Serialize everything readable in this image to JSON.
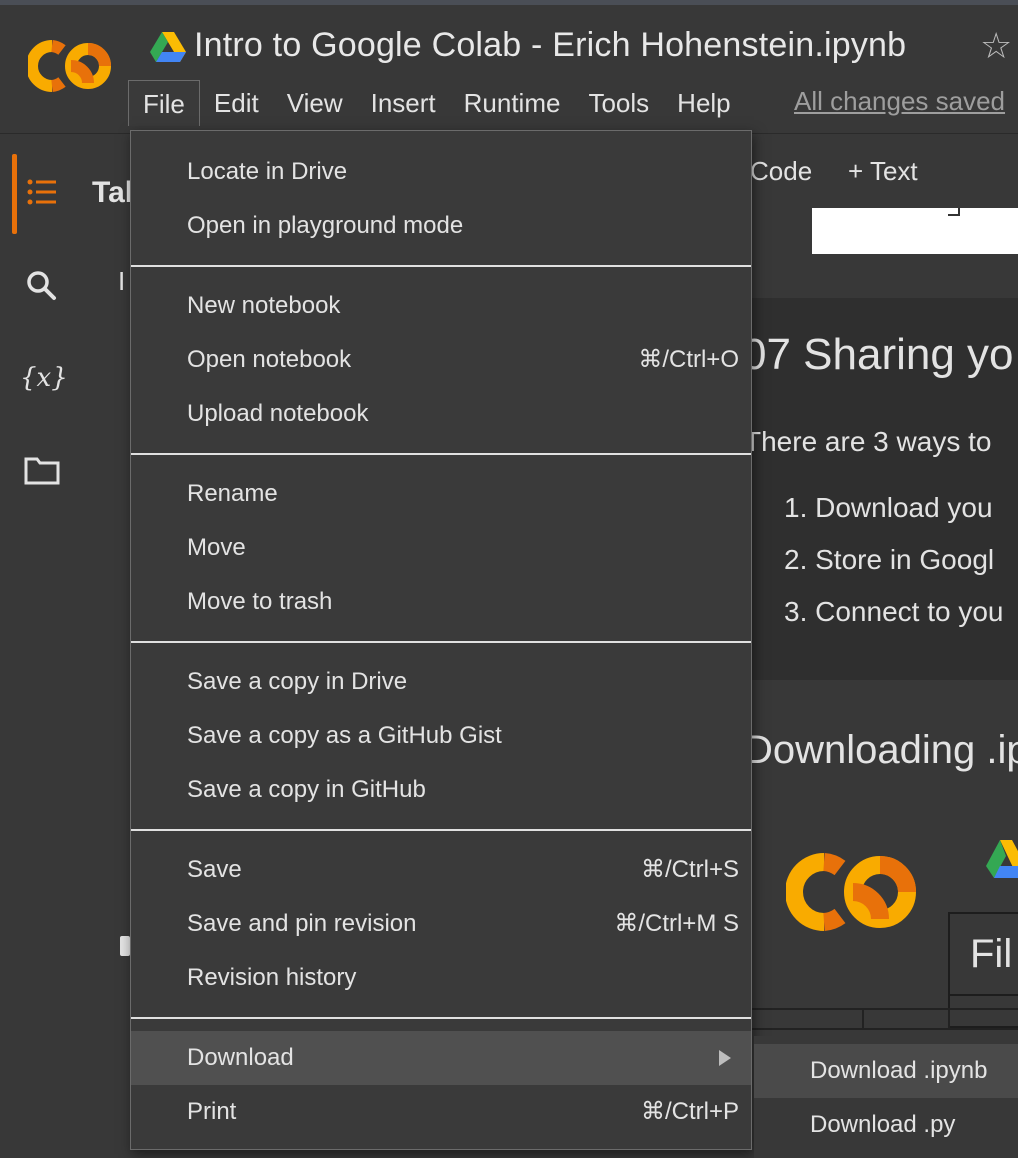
{
  "notebook": {
    "title": "Intro to Google Colab - Erich Hohenstein.ipynb",
    "saved_status": "All changes saved"
  },
  "menubar": [
    "File",
    "Edit",
    "View",
    "Insert",
    "Runtime",
    "Tools",
    "Help"
  ],
  "sidebar": {
    "icons": [
      "toc-icon",
      "search-icon",
      "variables-icon",
      "folder-icon"
    ],
    "variables_glyph": "{x}",
    "accent_color": "#e8710a"
  },
  "toc": {
    "title": "Tal",
    "entry": "I"
  },
  "toolbar": {
    "code": "Code",
    "text": "+ Text"
  },
  "notebook_content": {
    "heading": "07 Sharing yo",
    "paragraph": "There are 3 ways to",
    "list": [
      "1. Download you",
      "2. Store in Googl",
      "3. Connect to you"
    ],
    "heading2": "Downloading .ip",
    "mini_menu": "Fil"
  },
  "file_menu": {
    "groups": [
      [
        {
          "label": "Locate in Drive",
          "shortcut": ""
        },
        {
          "label": "Open in playground mode",
          "shortcut": ""
        }
      ],
      [
        {
          "label": "New notebook",
          "shortcut": ""
        },
        {
          "label": "Open notebook",
          "shortcut": "⌘/Ctrl+O"
        },
        {
          "label": "Upload notebook",
          "shortcut": ""
        }
      ],
      [
        {
          "label": "Rename",
          "shortcut": ""
        },
        {
          "label": "Move",
          "shortcut": ""
        },
        {
          "label": "Move to trash",
          "shortcut": ""
        }
      ],
      [
        {
          "label": "Save a copy in Drive",
          "shortcut": ""
        },
        {
          "label": "Save a copy as a GitHub Gist",
          "shortcut": ""
        },
        {
          "label": "Save a copy in GitHub",
          "shortcut": ""
        }
      ],
      [
        {
          "label": "Save",
          "shortcut": "⌘/Ctrl+S"
        },
        {
          "label": "Save and pin revision",
          "shortcut": "⌘/Ctrl+M S"
        },
        {
          "label": "Revision history",
          "shortcut": ""
        }
      ],
      [
        {
          "label": "Download",
          "shortcut": "",
          "submenu": true,
          "highlight": true
        },
        {
          "label": "Print",
          "shortcut": "⌘/Ctrl+P"
        }
      ]
    ]
  },
  "download_submenu": [
    {
      "label": "Download .ipynb",
      "highlight": true
    },
    {
      "label": "Download .py"
    }
  ],
  "colors": {
    "background": "#383838",
    "menu_bg": "#3a3a3a",
    "highlight": "#505050",
    "text": "#e3e3e3",
    "colab_orange": "#f9ab00",
    "colab_dark_orange": "#e8710a"
  }
}
